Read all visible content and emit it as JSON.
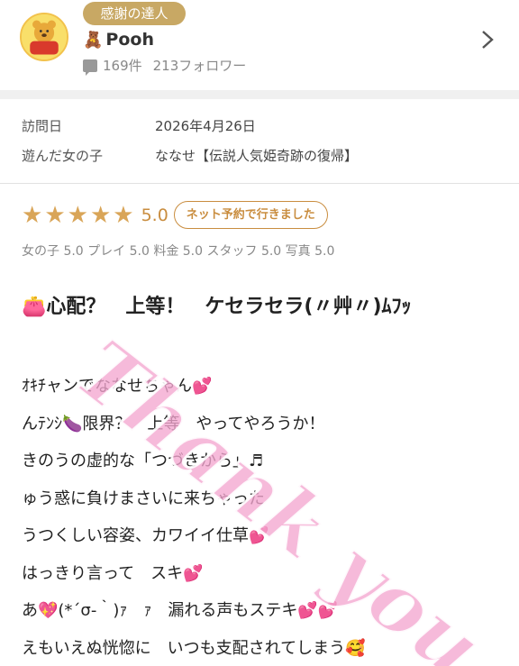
{
  "user": {
    "badge": "感謝の達人",
    "name": "Pooh",
    "bear": "🧸",
    "posts": "169件",
    "followers": "213フォロワー"
  },
  "visit": {
    "date_label": "訪問日",
    "date_value": "2026年4月26日",
    "girl_label": "遊んだ女の子",
    "girl_value": "ななせ【伝説人気姫奇跡の復帰】"
  },
  "rating": {
    "stars": 5,
    "score": "5.0",
    "reserve_badge": "ネット予約で行きました",
    "breakdown": "女の子 5.0 プレイ 5.0 料金 5.0 スタッフ 5.0 写真 5.0"
  },
  "review": {
    "title": "👛心配？　上等！　ケセラセラ(〃艸〃)ﾑﾌｯ",
    "lines": [
      "ｵｷﾁャンでななせちゃん💕",
      "んﾃﾝｼ🍆限界？　上等　やってやろうか！",
      "きのうの虚的な「つづきから」♬",
      "ゅう惑に負けまさいに来ちゃった",
      "うつくしい容姿、カワイイ仕草💕",
      "はっきり言って　スキ💕",
      "あ💖(*´σ-｀)ｧ　ｧ　漏れる声もステキ💕💕",
      "えもいえぬ恍惚に　いつも支配されてしまう🥰"
    ]
  },
  "watermark": "Thank you",
  "colors": {
    "gold": "#c98d3f",
    "star": "#d9a558",
    "badge_bg": "#c8a864",
    "watermark": "#f3a7cf"
  }
}
